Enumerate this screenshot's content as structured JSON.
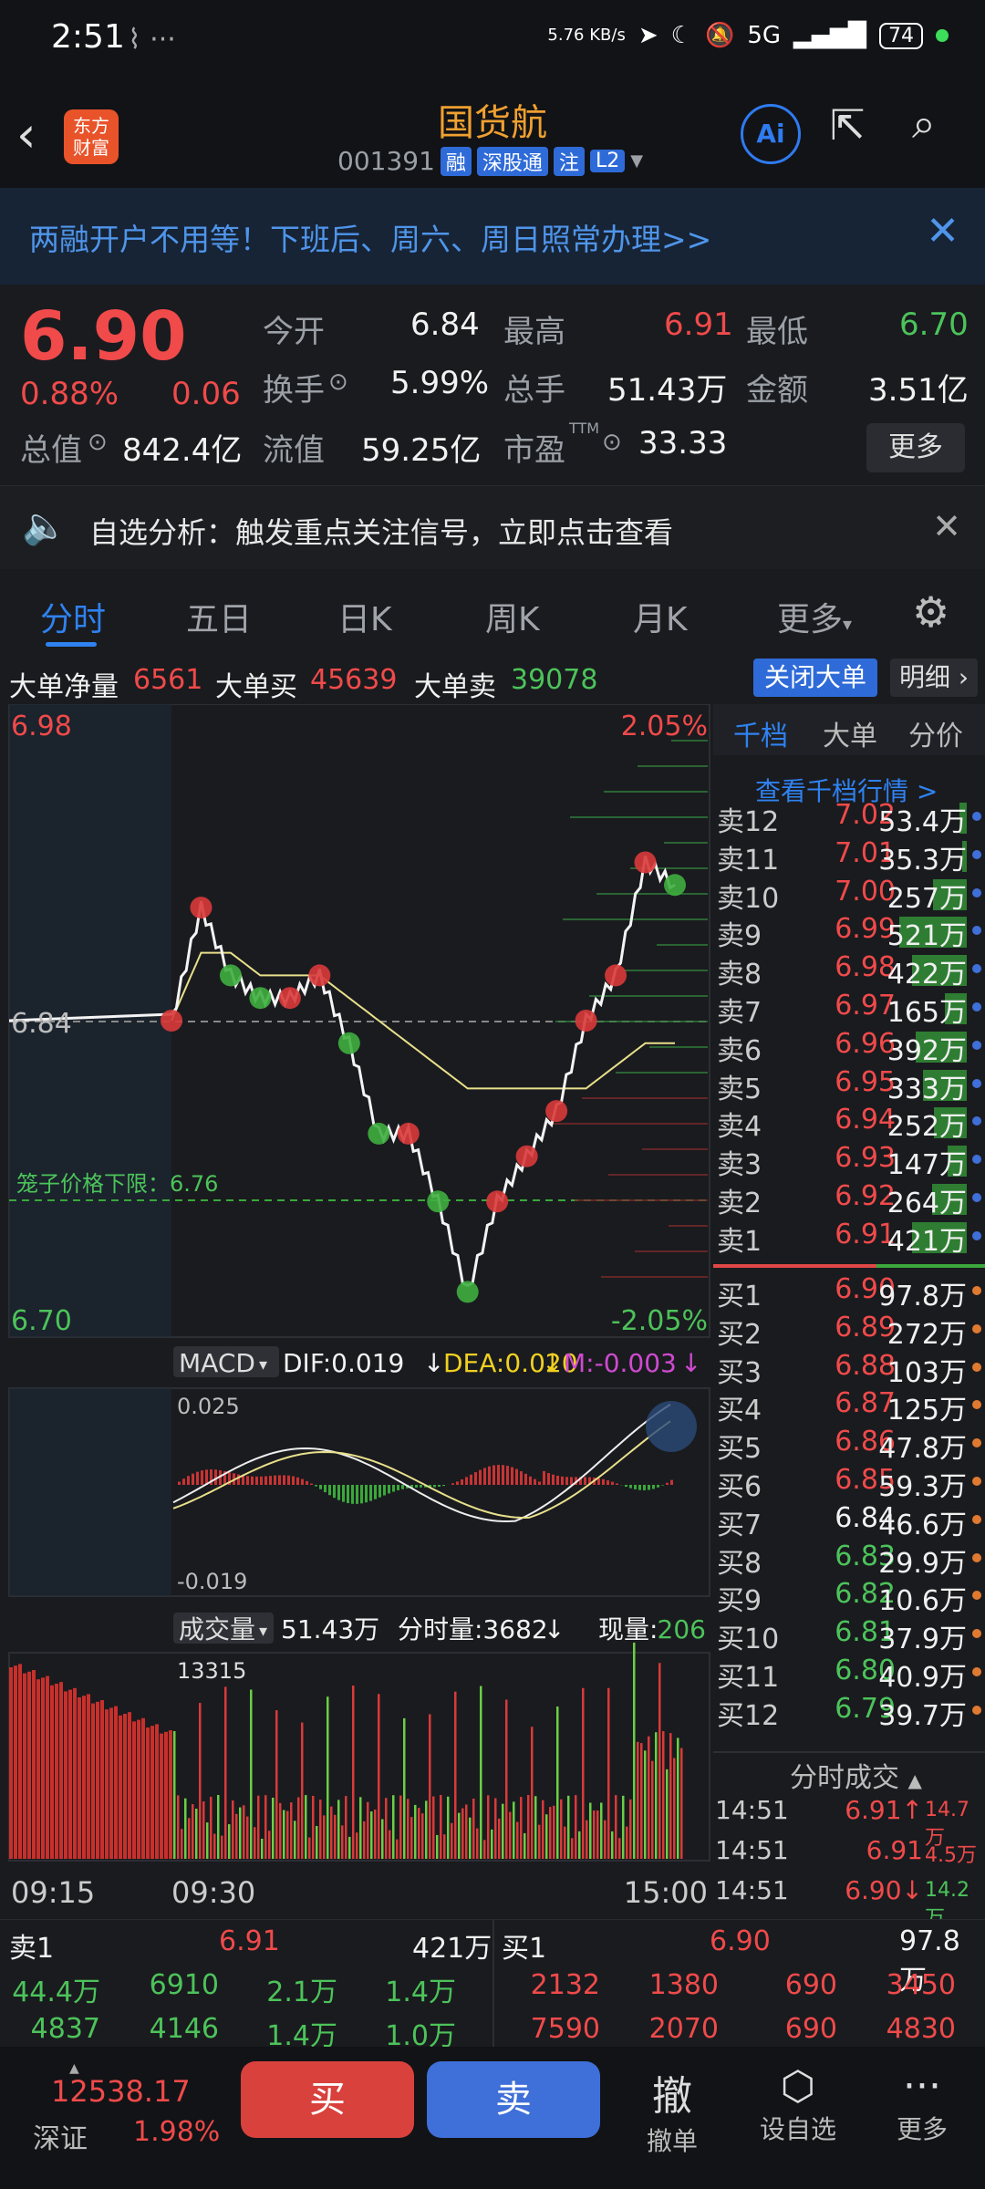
{
  "status": {
    "time": "2:51",
    "speed": "5.76 KB/s",
    "network": "5G",
    "battery": "74"
  },
  "header": {
    "title": "国货航",
    "code": "001391",
    "tags": [
      "融",
      "深股通",
      "注",
      "L2"
    ],
    "logo": "东方\n财富",
    "ai": "Ai"
  },
  "banner": {
    "text": "两融开户不用等！下班后、周六、周日照常办理>>"
  },
  "quote": {
    "price": "6.90",
    "pct": "0.88%",
    "chg": "0.06",
    "fields": [
      {
        "label": "今开",
        "value": "6.84"
      },
      {
        "label": "最高",
        "value": "6.91"
      },
      {
        "label": "最低",
        "value": "6.70"
      },
      {
        "label": "换手",
        "value": "5.99%"
      },
      {
        "label": "总手",
        "value": "51.43万"
      },
      {
        "label": "金额",
        "value": "3.51亿"
      },
      {
        "label": "总值",
        "value": "842.4亿"
      },
      {
        "label": "流值",
        "value": "59.25亿"
      },
      {
        "label": "市盈",
        "value": "33.33"
      }
    ],
    "ttm": "TTM",
    "more": "更多"
  },
  "notice": {
    "text": "自选分析：触发重点关注信号，立即点击查看"
  },
  "tabs": [
    "分时",
    "五日",
    "日K",
    "周K",
    "月K",
    "更多"
  ],
  "bigorder": {
    "net_label": "大单净量",
    "net": "6561",
    "buy_label": "大单买",
    "buy": "45639",
    "sell_label": "大单卖",
    "sell": "39078",
    "close_btn": "关闭大单",
    "detail_btn": "明细"
  },
  "chart_labels": {
    "top_price": "6.98",
    "top_pct": "2.05%",
    "bottom_price": "6.70",
    "bottom_pct": "-2.05%",
    "mid_price": "6.84",
    "cage": "笼子价格下限：6.76",
    "macd": "MACD",
    "dif": "DIF:0.019",
    "dea": "DEA:0.020",
    "m": "M:-0.003",
    "macd_top": "0.025",
    "macd_bottom": "-0.019",
    "vol_label": "成交量",
    "vol_total": "51.43万",
    "vol_fen": "分时量:3682",
    "vol_now_label": "现量:",
    "vol_now": "206",
    "vol_max": "13315",
    "time_start": "09:15",
    "time_open": "09:30",
    "time_end": "15:00"
  },
  "chart_data": {
    "type": "line",
    "title": "",
    "ylim": [
      6.7,
      6.98
    ],
    "prev_close": 6.84,
    "x": [
      "09:30",
      "09:45",
      "10:00",
      "10:15",
      "10:30",
      "10:45",
      "11:00",
      "11:15",
      "11:30",
      "13:00",
      "13:15",
      "13:30",
      "13:45",
      "14:00",
      "14:15",
      "14:30",
      "14:45",
      "14:51"
    ],
    "series": [
      {
        "values": [
          6.84,
          6.89,
          6.86,
          6.85,
          6.85,
          6.86,
          6.83,
          6.79,
          6.79,
          6.76,
          6.72,
          6.76,
          6.78,
          6.8,
          6.84,
          6.86,
          6.91,
          6.9
        ]
      },
      {
        "values": [
          6.84,
          6.87,
          6.87,
          6.86,
          6.86,
          6.86,
          6.85,
          6.84,
          6.83,
          6.82,
          6.81,
          6.81,
          6.81,
          6.81,
          6.81,
          6.82,
          6.83,
          6.83
        ]
      }
    ]
  },
  "book": {
    "tabs": [
      "千档",
      "大单",
      "分价"
    ],
    "link": "查看千档行情 >",
    "sells": [
      {
        "lbl": "卖12",
        "p": "7.02",
        "v": "53.4万"
      },
      {
        "lbl": "卖11",
        "p": "7.01",
        "v": "35.3万"
      },
      {
        "lbl": "卖10",
        "p": "7.00",
        "v": "257万"
      },
      {
        "lbl": "卖9",
        "p": "6.99",
        "v": "521万"
      },
      {
        "lbl": "卖8",
        "p": "6.98",
        "v": "422万"
      },
      {
        "lbl": "卖7",
        "p": "6.97",
        "v": "165万"
      },
      {
        "lbl": "卖6",
        "p": "6.96",
        "v": "392万"
      },
      {
        "lbl": "卖5",
        "p": "6.95",
        "v": "333万"
      },
      {
        "lbl": "卖4",
        "p": "6.94",
        "v": "252万"
      },
      {
        "lbl": "卖3",
        "p": "6.93",
        "v": "147万"
      },
      {
        "lbl": "卖2",
        "p": "6.92",
        "v": "264万"
      },
      {
        "lbl": "卖1",
        "p": "6.91",
        "v": "421万"
      }
    ],
    "buys": [
      {
        "lbl": "买1",
        "p": "6.90",
        "v": "97.8万"
      },
      {
        "lbl": "买2",
        "p": "6.89",
        "v": "272万"
      },
      {
        "lbl": "买3",
        "p": "6.88",
        "v": "103万"
      },
      {
        "lbl": "买4",
        "p": "6.87",
        "v": "125万"
      },
      {
        "lbl": "买5",
        "p": "6.86",
        "v": "47.8万"
      },
      {
        "lbl": "买6",
        "p": "6.85",
        "v": "59.3万"
      },
      {
        "lbl": "买7",
        "p": "6.84",
        "v": "46.6万"
      },
      {
        "lbl": "买8",
        "p": "6.83",
        "v": "29.9万"
      },
      {
        "lbl": "买9",
        "p": "6.82",
        "v": "10.6万"
      },
      {
        "lbl": "买10",
        "p": "6.81",
        "v": "37.9万"
      },
      {
        "lbl": "买11",
        "p": "6.80",
        "v": "40.9万"
      },
      {
        "lbl": "买12",
        "p": "6.79",
        "v": "39.7万"
      }
    ],
    "trades_title": "分时成交",
    "trades": [
      {
        "t": "14:51",
        "p": "6.91",
        "v": "14.7万",
        "dir": "up"
      },
      {
        "t": "14:51",
        "p": "6.91",
        "v": "4.5万",
        "dir": ""
      },
      {
        "t": "14:51",
        "p": "6.90",
        "v": "14.2万",
        "dir": "down"
      }
    ]
  },
  "traderow": {
    "s1": "卖1",
    "s1p": "6.91",
    "s1v": "421万",
    "b1": "买1",
    "b1p": "6.90",
    "b1v": "97.8万",
    "left_nums": [
      "44.4万",
      "6910",
      "2.1万",
      "1.4万",
      "4837",
      "4146",
      "1.4万",
      "1.0万"
    ],
    "right_nums": [
      "2132",
      "1380",
      "690",
      "3450",
      "7590",
      "2070",
      "690",
      "4830"
    ]
  },
  "footer": {
    "index": "12538.17",
    "index_name": "深证",
    "index_pct": "1.98%",
    "buy": "买",
    "sell": "卖",
    "withdraw": "撤",
    "withdraw_label": "撤单",
    "settings": "设自选",
    "more": "更多"
  }
}
